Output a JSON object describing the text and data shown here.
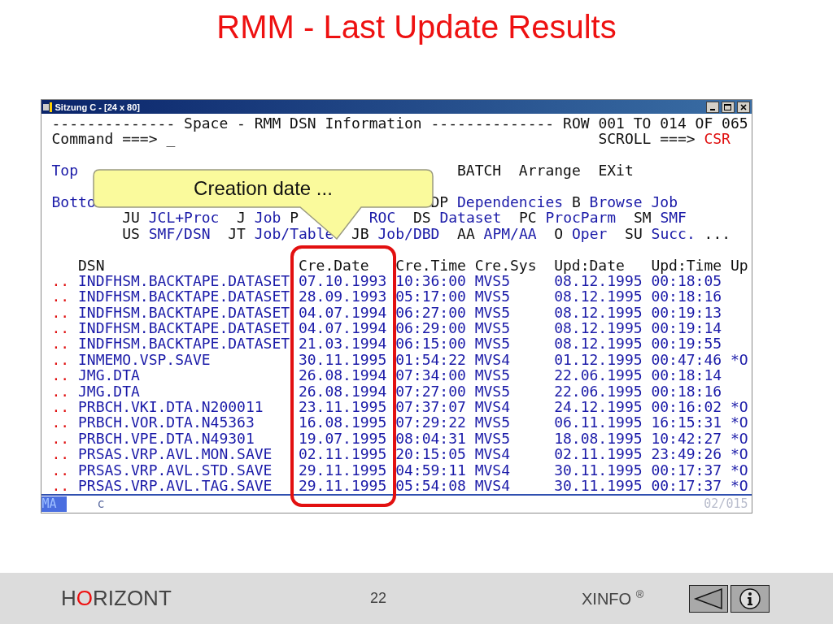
{
  "slide": {
    "title": "RMM - Last Update Results"
  },
  "window": {
    "title": "Sitzung C - [24 x 80]"
  },
  "terminal": {
    "header": "-------------- Space - RMM DSN Information -------------- ROW 001 TO 014 OF 065",
    "command": {
      "label": "Command ===> ",
      "cursor": "_"
    },
    "scroll": {
      "label": "SCROLL ===> ",
      "value": "CSR"
    },
    "menu_lines": [
      [
        {
          "text": "Top",
          "kind": "link"
        },
        {
          "text": "                                           BATCH  Arrange  EXit",
          "kind": "plain"
        }
      ],
      [
        {
          "text": "Botto",
          "kind": "link"
        },
        {
          "text": "                                      DP ",
          "kind": "plain"
        },
        {
          "text": "Dependencies",
          "kind": "link"
        },
        {
          "text": " B ",
          "kind": "plain"
        },
        {
          "text": "Browse Job",
          "kind": "link"
        }
      ],
      [
        {
          "text": "        JU ",
          "kind": "plain"
        },
        {
          "text": "JCL+Proc",
          "kind": "link"
        },
        {
          "text": "  J ",
          "kind": "plain"
        },
        {
          "text": "Job",
          "kind": "link"
        },
        {
          "text": " P",
          "kind": "plain"
        },
        {
          "text": "        ROC",
          "kind": "link"
        },
        {
          "text": "  DS ",
          "kind": "plain"
        },
        {
          "text": "Dataset",
          "kind": "link"
        },
        {
          "text": "  PC ",
          "kind": "plain"
        },
        {
          "text": "ProcParm",
          "kind": "link"
        },
        {
          "text": "  SM ",
          "kind": "plain"
        },
        {
          "text": "SMF",
          "kind": "link"
        }
      ],
      [
        {
          "text": "        US ",
          "kind": "plain"
        },
        {
          "text": "SMF/DSN",
          "kind": "link"
        },
        {
          "text": "  JT ",
          "kind": "plain"
        },
        {
          "text": "Job/Table",
          "kind": "link"
        },
        {
          "text": "  JB ",
          "kind": "plain"
        },
        {
          "text": "Job/DBD",
          "kind": "link"
        },
        {
          "text": "  AA ",
          "kind": "plain"
        },
        {
          "text": "APM/AA",
          "kind": "link"
        },
        {
          "text": "  O ",
          "kind": "plain"
        },
        {
          "text": "Oper",
          "kind": "link"
        },
        {
          "text": "  SU ",
          "kind": "plain"
        },
        {
          "text": "Succ.",
          "kind": "link"
        },
        {
          "text": " ...",
          "kind": "plain"
        }
      ]
    ],
    "columns": [
      "DSN",
      "Cre.Date",
      "Cre.Time",
      "Cre.Sys",
      "Upd:Date",
      "Upd:Time",
      "Up"
    ],
    "rows": [
      {
        "prefix": "..",
        "cells": [
          "INDFHSM.BACKTAPE.DATASET",
          "07.10.1993",
          "10:36:00",
          "MVS5",
          "08.12.1995",
          "00:18:05"
        ]
      },
      {
        "prefix": "..",
        "cells": [
          "INDFHSM.BACKTAPE.DATASET",
          "28.09.1993",
          "05:17:00",
          "MVS5",
          "08.12.1995",
          "00:18:16"
        ]
      },
      {
        "prefix": "..",
        "cells": [
          "INDFHSM.BACKTAPE.DATASET",
          "04.07.1994",
          "06:27:00",
          "MVS5",
          "08.12.1995",
          "00:19:13"
        ]
      },
      {
        "prefix": "..",
        "cells": [
          "INDFHSM.BACKTAPE.DATASET",
          "04.07.1994",
          "06:29:00",
          "MVS5",
          "08.12.1995",
          "00:19:14"
        ]
      },
      {
        "prefix": "..",
        "cells": [
          "INDFHSM.BACKTAPE.DATASET",
          "21.03.1994",
          "06:15:00",
          "MVS5",
          "08.12.1995",
          "00:19:55"
        ]
      },
      {
        "prefix": "..",
        "cells": [
          "INMEMO.VSP.SAVE",
          "30.11.1995",
          "01:54:22",
          "MVS4",
          "01.12.1995",
          "00:47:46"
        ],
        "flag": "*O"
      },
      {
        "prefix": "..",
        "cells": [
          "JMG.DTA",
          "26.08.1994",
          "07:34:00",
          "MVS5",
          "22.06.1995",
          "00:18:14"
        ]
      },
      {
        "prefix": "..",
        "cells": [
          "JMG.DTA",
          "26.08.1994",
          "07:27:00",
          "MVS5",
          "22.06.1995",
          "00:18:16"
        ]
      },
      {
        "prefix": "..",
        "cells": [
          "PRBCH.VKI.DTA.N200011",
          "23.11.1995",
          "07:37:07",
          "MVS4",
          "24.12.1995",
          "00:16:02"
        ],
        "flag": "*O"
      },
      {
        "prefix": "..",
        "cells": [
          "PRBCH.VOR.DTA.N45363",
          "16.08.1995",
          "07:29:22",
          "MVS5",
          "06.11.1995",
          "16:15:31"
        ],
        "flag": "*O"
      },
      {
        "prefix": "..",
        "cells": [
          "PRBCH.VPE.DTA.N49301",
          "19.07.1995",
          "08:04:31",
          "MVS5",
          "18.08.1995",
          "10:42:27"
        ],
        "flag": "*O"
      },
      {
        "prefix": "..",
        "cells": [
          "PRSAS.VRP.AVL.MON.SAVE",
          "02.11.1995",
          "20:15:05",
          "MVS4",
          "02.11.1995",
          "23:49:26"
        ],
        "flag": "*O"
      },
      {
        "prefix": "..",
        "cells": [
          "PRSAS.VRP.AVL.STD.SAVE",
          "29.11.1995",
          "04:59:11",
          "MVS4",
          "30.11.1995",
          "00:17:37"
        ],
        "flag": "*O"
      },
      {
        "prefix": "..",
        "cells": [
          "PRSAS.VRP.AVL.TAG.SAVE",
          "29.11.1995",
          "05:54:08",
          "MVS4",
          "30.11.1995",
          "00:17:37"
        ],
        "flag": "*O"
      }
    ],
    "status": {
      "mode": "MA",
      "field": "c",
      "position": "02/015"
    }
  },
  "callout": {
    "text": "Creation date ..."
  },
  "footer": {
    "brand": [
      {
        "text": "H",
        "accent": false
      },
      {
        "text": "O",
        "accent": true
      },
      {
        "text": "RIZONT",
        "accent": false
      }
    ],
    "page": "22",
    "product": "XINFO $^{®}$"
  }
}
